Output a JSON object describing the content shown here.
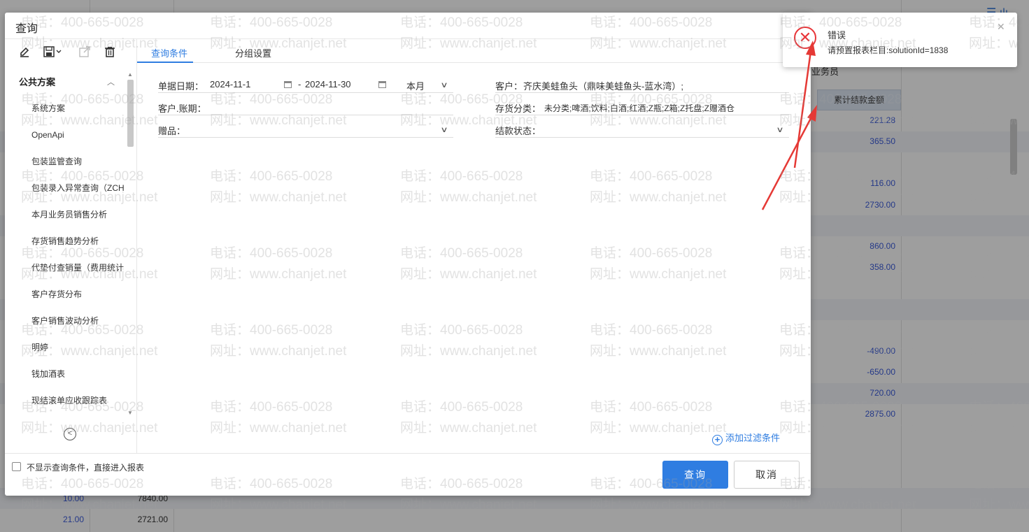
{
  "background": {
    "header_text": "业务员",
    "column_header": "累计结款金额",
    "right_values": [
      "221.28",
      "365.50",
      "116.00",
      "2730.00",
      "860.00",
      "358.00",
      "-490.00",
      "-650.00",
      "720.00",
      "2875.00"
    ],
    "bottom_rows": [
      {
        "qty": "10.00",
        "amount": "7840.00"
      },
      {
        "qty": "21.00",
        "amount": "2721.00"
      }
    ]
  },
  "dialog": {
    "title": "查询",
    "toolbar": {
      "edit_icon": "pencil-icon",
      "save_icon": "save-icon",
      "export_icon": "export-icon",
      "delete_icon": "trash-icon"
    },
    "schemes": {
      "group_label": "公共方案",
      "items": [
        "系统方案",
        "OpenApi",
        "包装监管查询",
        "包装录入异常查询（ZCH",
        "本月业务员销售分析",
        "存货销售趋势分析",
        "代垫付查销量（费用统计",
        "客户存货分布",
        "客户销售波动分析",
        "明婷",
        "钱加酒表",
        "现结滚单应收跟踪表"
      ]
    },
    "tabs": [
      {
        "label": "查询条件",
        "active": true
      },
      {
        "label": "分组设置",
        "active": false
      }
    ],
    "form": {
      "date_label": "单据日期：",
      "date_from": "2024-11-1",
      "date_sep": "-",
      "date_to": "2024-11-30",
      "period": "本月",
      "customer_label": "客户：",
      "customer_value": "齐庆美蛙鱼头（鼎味美蛙鱼头-蓝水湾）;",
      "account_period_label": "客户.账期：",
      "inventory_label": "存货分类：",
      "inventory_value": "未分类;啤酒;饮料;白酒;红酒;Z瓶;Z箱;Z托盘;Z赠酒仓",
      "gift_label": "赠品：",
      "settle_label": "结款状态："
    },
    "add_filter": "添加过滤条件",
    "skip_checkbox_label": "不显示查询条件，直接进入报表",
    "query_button": "查询",
    "cancel_button": "取消"
  },
  "toast": {
    "title": "错误",
    "message": "请预置报表栏目:solutionId=1838"
  },
  "watermark": {
    "phone": "电话：400-665-0028",
    "site": "网址：www.chanjet.net"
  },
  "colors": {
    "accent": "#2f7de1",
    "error": "#e8363a",
    "annotation": "#e53935"
  }
}
